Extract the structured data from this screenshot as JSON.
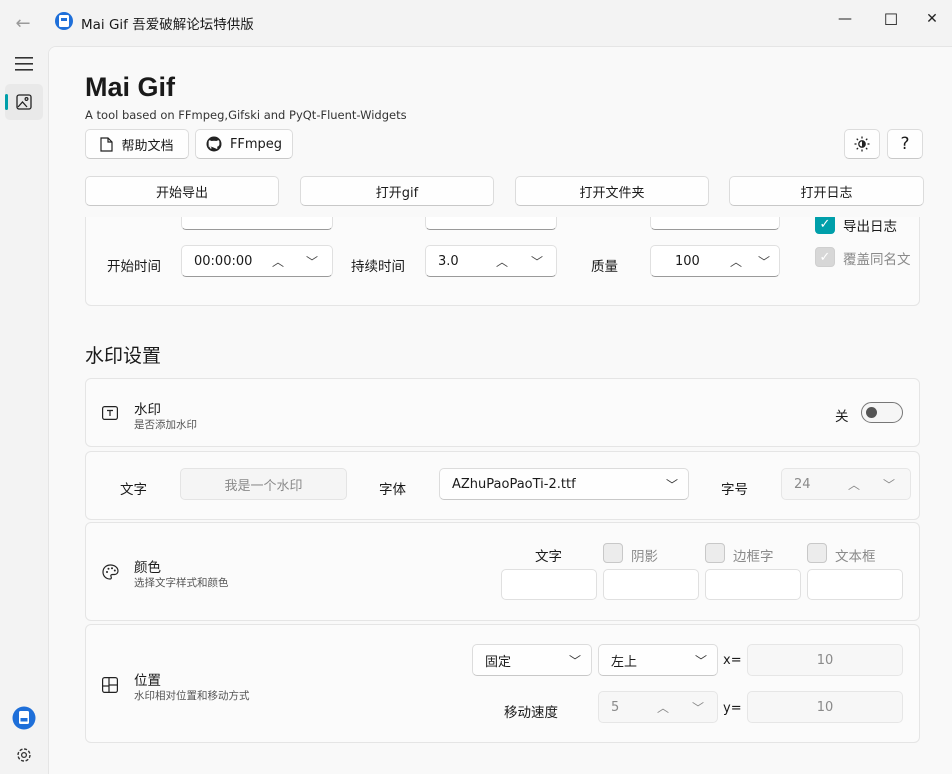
{
  "window": {
    "title": "Mai Gif  吾爱破解论坛特供版",
    "minimize_glyph": "—",
    "maximize_glyph": "☐",
    "close_glyph": "✕",
    "back_glyph": "←"
  },
  "header": {
    "title": "Mai Gif",
    "subtitle": "A tool based on FFmpeg,Gifski and PyQt-Fluent-Widgets",
    "help_doc_label": "帮助文档",
    "ffmpeg_label": "FFmpeg",
    "help_glyph": "?"
  },
  "actions": {
    "start_export": "开始导出",
    "open_gif": "打开gif",
    "open_folder": "打开文件夹",
    "open_log": "打开日志"
  },
  "export_settings": {
    "start_time_label": "开始时间",
    "start_time_value": "00:00:00",
    "duration_label": "持续时间",
    "duration_value": "3.0",
    "quality_label": "质量",
    "quality_value": "100",
    "export_log_label": "导出日志",
    "export_log_checked": true,
    "overwrite_label": "覆盖同名文",
    "overwrite_checked": true
  },
  "watermark": {
    "section_title": "水印设置",
    "toggle_title": "水印",
    "toggle_desc": "是否添加水印",
    "toggle_state_label": "关",
    "toggle_on": false,
    "text_label": "文字",
    "text_placeholder": "我是一个水印",
    "font_label": "字体",
    "font_value": "AZhuPaoPaoTi-2.ttf",
    "size_label": "字号",
    "size_value": "24",
    "color_title": "颜色",
    "color_desc": "选择文字样式和颜色",
    "color_text_label": "文字",
    "shadow_label": "阴影",
    "border_text_label": "边框字",
    "text_box_label": "文本框",
    "position_title": "位置",
    "position_desc": "水印相对位置和移动方式",
    "mode_value": "固定",
    "anchor_value": "左上",
    "x_label": "x=",
    "x_value": "10",
    "speed_label": "移动速度",
    "speed_value": "5",
    "y_label": "y=",
    "y_value": "10"
  },
  "colors": {
    "accent": "#009faa",
    "background": "#f3f3f3",
    "card": "#fbfbfb"
  }
}
